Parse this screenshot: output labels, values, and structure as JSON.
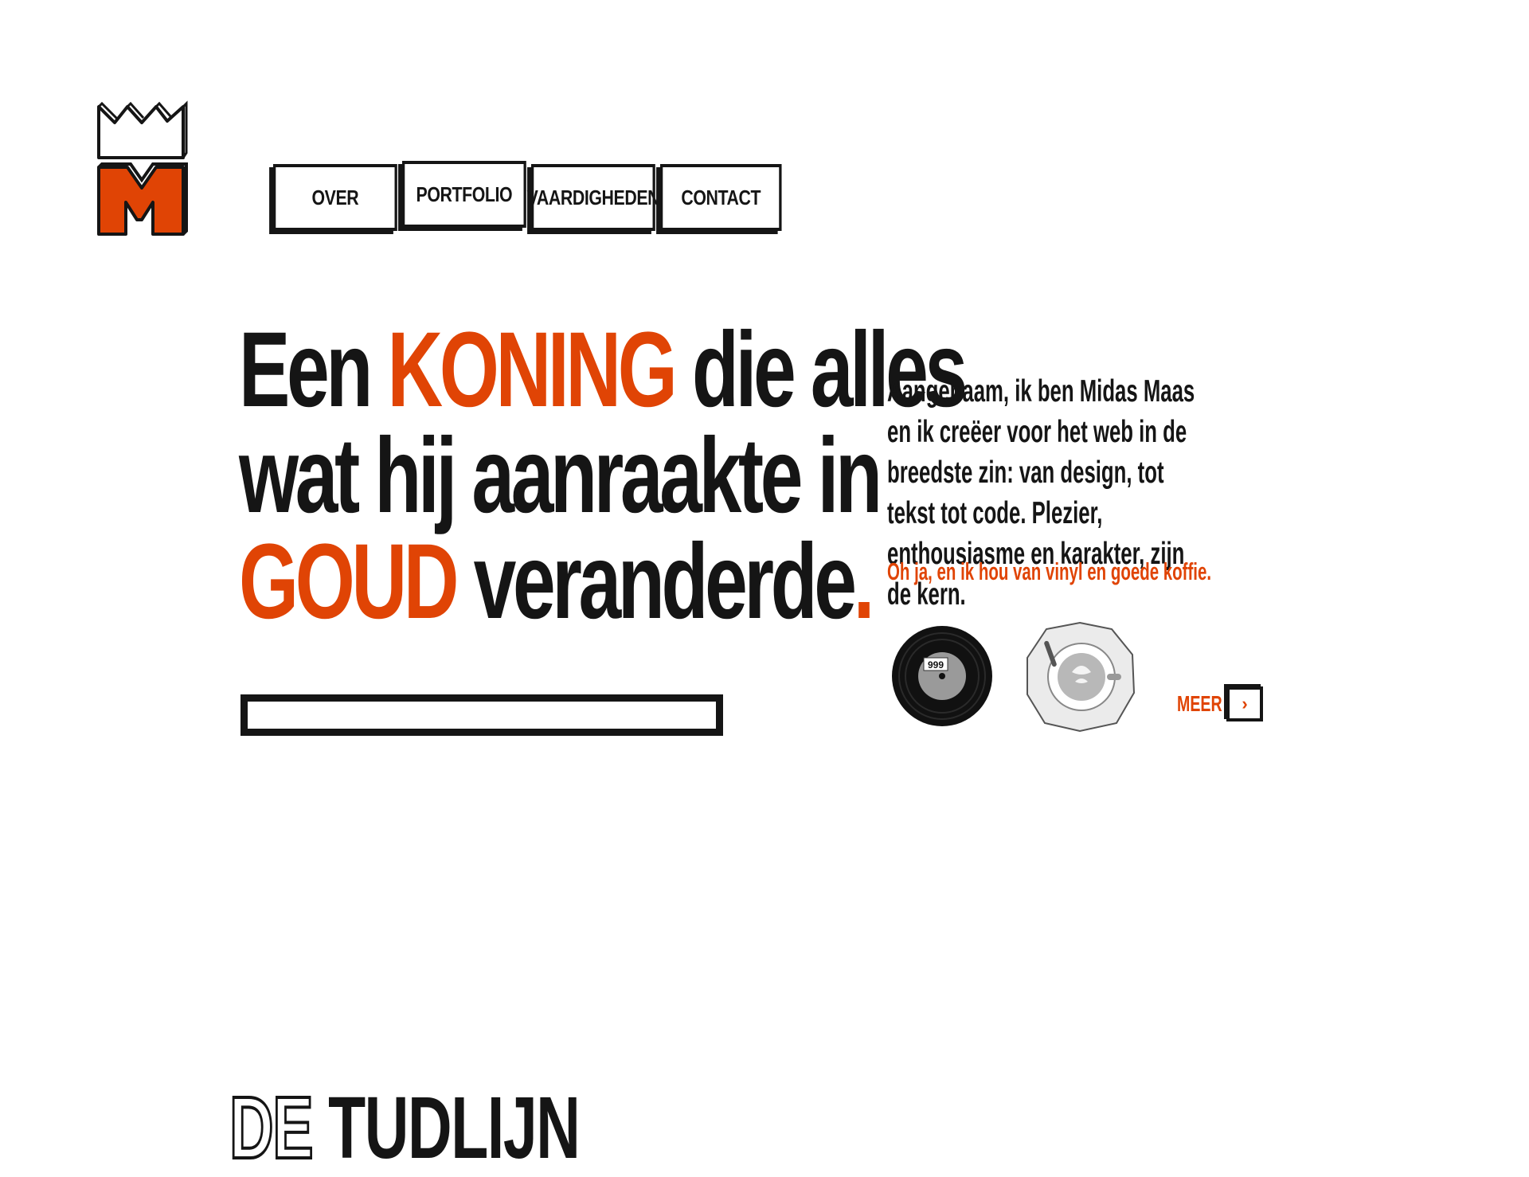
{
  "brand": {
    "logo_icon": "crown-m-logo",
    "accent_color": "#e04405",
    "ink_color": "#151515"
  },
  "nav": {
    "items": [
      {
        "label": "OVER"
      },
      {
        "label": "PORTFOLIO"
      },
      {
        "label": "VAARDIGHEDEN"
      },
      {
        "label": "CONTACT"
      }
    ]
  },
  "hero": {
    "headline": {
      "part1": "Een ",
      "koning": "KONING",
      "part2": " die alles",
      "part3": "wat hij aanraakte in",
      "goud": "GOUD",
      "part4": " veranderde",
      "dot": "."
    }
  },
  "intro": {
    "text": "Aangenaam, ik ben Midas Maas en ik creëer voor het web in de breedste zin: van design, tot tekst tot code. Plezier, enthousiasme en karakter, zijn de kern.",
    "sub": "Oh ja, en ik hou van vinyl en goede koffie.",
    "vinyl_label": "999",
    "more_label": "MEER",
    "more_icon": "chevron-right-icon"
  },
  "section": {
    "title_outline": "DE",
    "title_solid": "TUDLIJN"
  }
}
